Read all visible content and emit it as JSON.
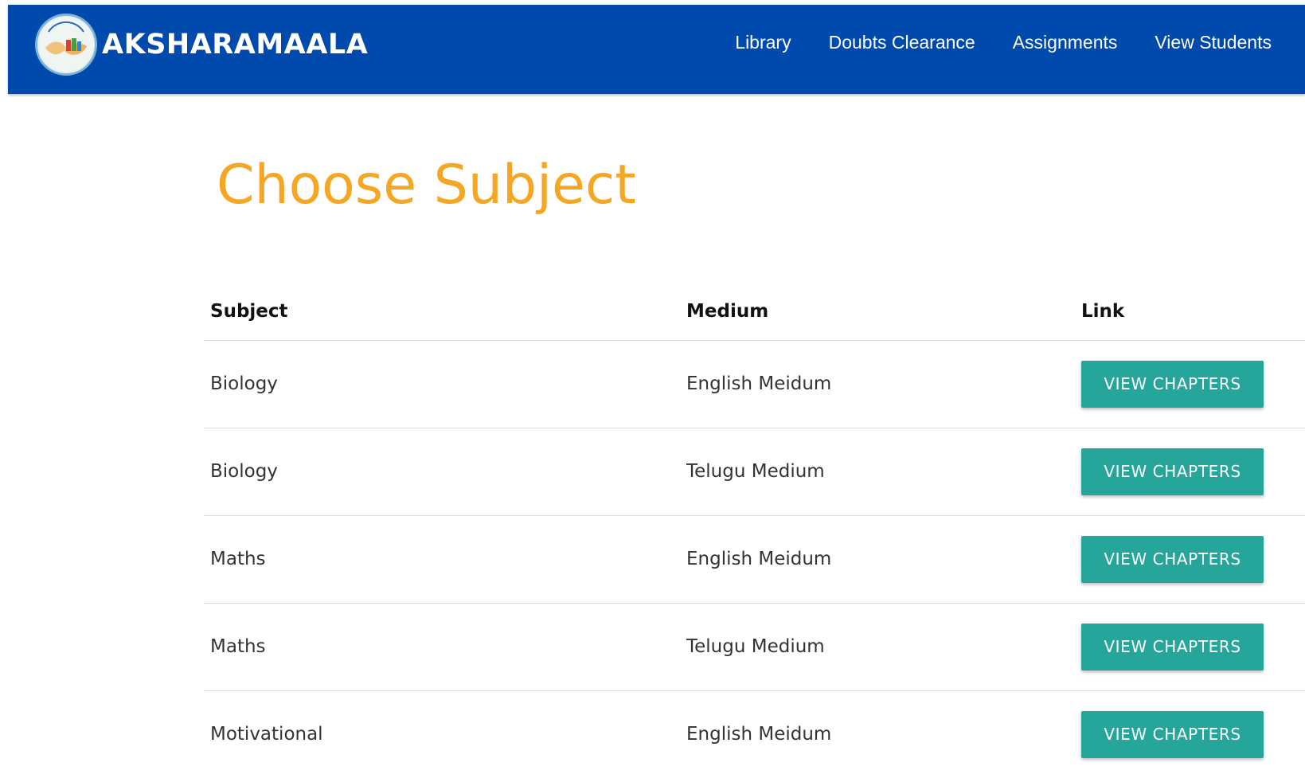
{
  "brand": {
    "name": "AKSHARAMAALA",
    "logo_icon": "aksharamaala-logo"
  },
  "nav": {
    "items": [
      {
        "label": "Library"
      },
      {
        "label": "Doubts Clearance"
      },
      {
        "label": "Assignments"
      },
      {
        "label": "View Students"
      }
    ]
  },
  "page": {
    "title": "Choose Subject"
  },
  "table": {
    "headers": {
      "subject": "Subject",
      "medium": "Medium",
      "link": "Link"
    },
    "rows": [
      {
        "subject": "Biology",
        "medium": "English Meidum",
        "button": "VIEW CHAPTERS"
      },
      {
        "subject": "Biology",
        "medium": "Telugu Medium",
        "button": "VIEW CHAPTERS"
      },
      {
        "subject": "Maths",
        "medium": "English Meidum",
        "button": "VIEW CHAPTERS"
      },
      {
        "subject": "Maths",
        "medium": "Telugu Medium",
        "button": "VIEW CHAPTERS"
      },
      {
        "subject": "Motivational",
        "medium": "English Meidum",
        "button": "VIEW CHAPTERS"
      }
    ]
  },
  "colors": {
    "navbar": "#004aad",
    "title": "#f5a623",
    "button": "#26a69a"
  }
}
